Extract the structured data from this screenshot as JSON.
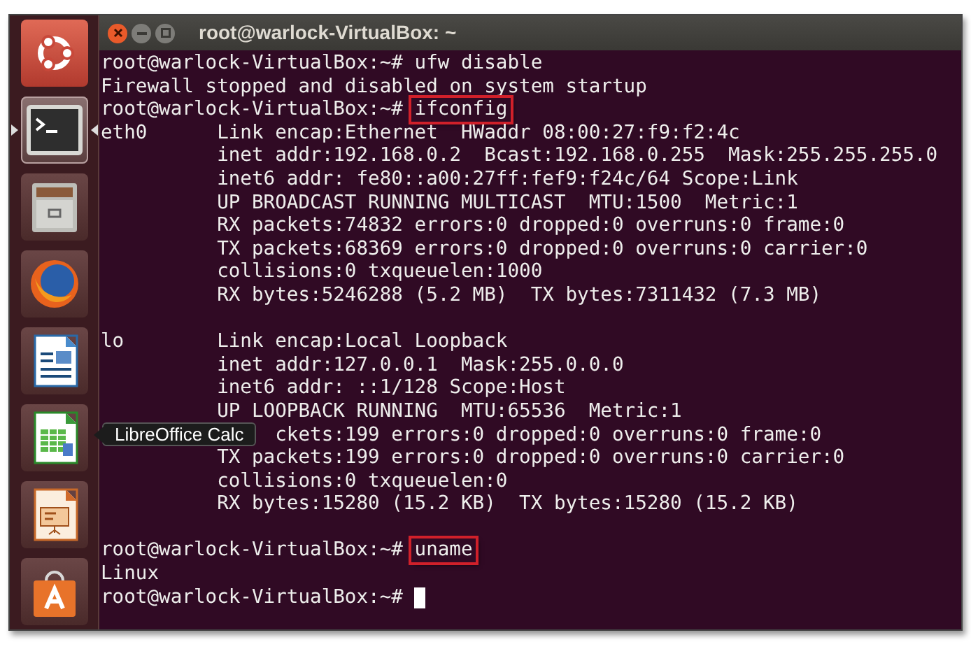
{
  "window": {
    "title": "root@warlock-VirtualBox: ~"
  },
  "launcher": [
    {
      "kind": "dash",
      "active": false
    },
    {
      "kind": "terminal",
      "active": true
    },
    {
      "kind": "files",
      "active": false
    },
    {
      "kind": "browser",
      "active": false
    },
    {
      "kind": "writer",
      "active": false
    },
    {
      "kind": "calc",
      "active": false,
      "tooltip": "LibreOffice Calc"
    },
    {
      "kind": "impress",
      "active": false
    },
    {
      "kind": "store",
      "active": false
    }
  ],
  "terminal": [
    {
      "kind": "prompt",
      "prompt": "root@warlock-VirtualBox:~#",
      "command": "ufw disable",
      "highlighted": false
    },
    {
      "kind": "output",
      "text": "Firewall stopped and disabled on system startup"
    },
    {
      "kind": "prompt",
      "prompt": "root@warlock-VirtualBox:~#",
      "command": "ifconfig",
      "highlighted": true
    },
    {
      "kind": "detail",
      "label": "eth0",
      "text": "Link encap:Ethernet  HWaddr 08:00:27:f9:f2:4c"
    },
    {
      "kind": "detail",
      "text": "inet addr:192.168.0.2  Bcast:192.168.0.255  Mask:255.255.255.0"
    },
    {
      "kind": "detail",
      "text": "inet6 addr: fe80::a00:27ff:fef9:f24c/64 Scope:Link"
    },
    {
      "kind": "detail",
      "text": "UP BROADCAST RUNNING MULTICAST  MTU:1500  Metric:1"
    },
    {
      "kind": "detail",
      "text": "RX packets:74832 errors:0 dropped:0 overruns:0 frame:0"
    },
    {
      "kind": "detail",
      "text": "TX packets:68369 errors:0 dropped:0 overruns:0 carrier:0"
    },
    {
      "kind": "detail",
      "text": "collisions:0 txqueuelen:1000"
    },
    {
      "kind": "detail",
      "text": "RX bytes:5246288 (5.2 MB)  TX bytes:7311432 (7.3 MB)"
    },
    {
      "kind": "blank"
    },
    {
      "kind": "detail",
      "label": "lo",
      "text": "Link encap:Local Loopback"
    },
    {
      "kind": "detail",
      "text": "inet addr:127.0.0.1  Mask:255.0.0.0"
    },
    {
      "kind": "detail",
      "text": "inet6 addr: ::1/128 Scope:Host"
    },
    {
      "kind": "detail",
      "text": "UP LOOPBACK RUNNING  MTU:65536  Metric:1"
    },
    {
      "kind": "covered",
      "text": "ckets:199 errors:0 dropped:0 overruns:0 frame:0"
    },
    {
      "kind": "detail",
      "text": "TX packets:199 errors:0 dropped:0 overruns:0 carrier:0"
    },
    {
      "kind": "detail",
      "text": "collisions:0 txqueuelen:0"
    },
    {
      "kind": "detail",
      "text": "RX bytes:15280 (15.2 KB)  TX bytes:15280 (15.2 KB)"
    },
    {
      "kind": "blank"
    },
    {
      "kind": "prompt",
      "prompt": "root@warlock-VirtualBox:~#",
      "command": "uname",
      "highlighted": true
    },
    {
      "kind": "output",
      "text": "Linux"
    },
    {
      "kind": "prompt",
      "prompt": "root@warlock-VirtualBox:~#",
      "cursor": true
    }
  ]
}
